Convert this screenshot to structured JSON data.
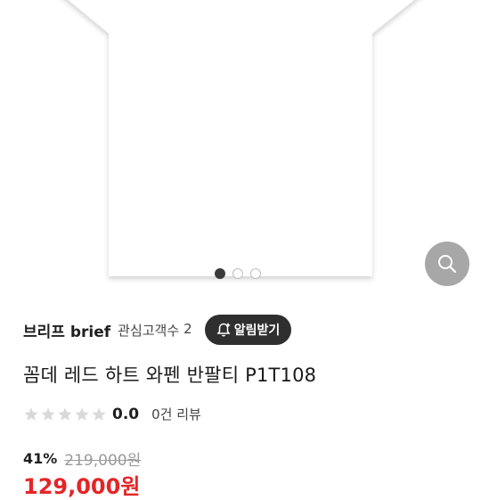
{
  "gallery": {
    "image_alt": "white t-shirt product photo",
    "dots": [
      {
        "state": "active"
      },
      {
        "state": "inactive"
      },
      {
        "state": "inactive"
      }
    ],
    "zoom_icon": "search-icon"
  },
  "seller": {
    "name": "브리프 brief",
    "followers_label": "관심고객수",
    "followers_count": "2",
    "notify_button_label": "알림받기",
    "notify_icon": "bell-plus-icon"
  },
  "product": {
    "title": "꼼데 레드 하트 와펜 반팔티 P1T108",
    "rating_value": "0.0",
    "star_count": 5,
    "reviews_label": "0건 리뷰",
    "discount": "41%",
    "original_price": "219,000원",
    "sale_price": "129,000원"
  },
  "colors": {
    "accent_red": "#e52528",
    "button_dark": "#2f2f2f",
    "star_empty": "#d9d9d9",
    "zoom_button": "#a7a7a7"
  }
}
